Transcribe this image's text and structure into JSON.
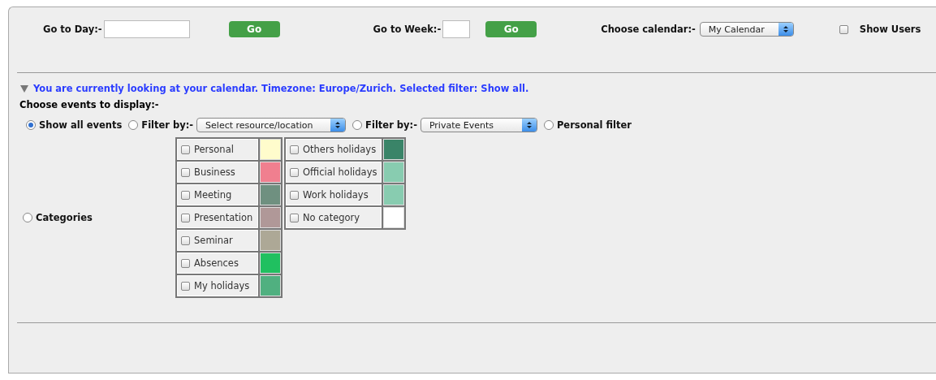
{
  "toolbar": {
    "day": {
      "label": "Go to Day:-",
      "button": "Go"
    },
    "week": {
      "label": "Go to Week:-",
      "button": "Go"
    },
    "calendar": {
      "label": "Choose calendar:-",
      "value": "My Calendar"
    },
    "show_users": {
      "label": "Show Users",
      "checked": false
    }
  },
  "info": {
    "expanded": true,
    "text": "You are currently looking at your calendar. Timezone: Europe/Zurich. Selected filter: Show all."
  },
  "events_heading": "Choose events to display:-",
  "filters": [
    {
      "kind": "radio",
      "label": "Show all events",
      "selected": true
    },
    {
      "kind": "select",
      "label": "Filter by:-",
      "value": "Select resource/location",
      "selected": false
    },
    {
      "kind": "select",
      "label": "Filter by:-",
      "value": "Private Events",
      "selected": false
    },
    {
      "kind": "radio",
      "label": "Personal filter",
      "selected": false
    }
  ],
  "categories": {
    "label": "Categories",
    "selected": false,
    "columns": [
      [
        {
          "name": "Personal",
          "checked": false,
          "color": "#fffccc"
        },
        {
          "name": "Business",
          "checked": false,
          "color": "#f07f8f"
        },
        {
          "name": "Meeting",
          "checked": false,
          "color": "#6f9080"
        },
        {
          "name": "Presentation",
          "checked": false,
          "color": "#b09898"
        },
        {
          "name": "Seminar",
          "checked": false,
          "color": "#ada896"
        },
        {
          "name": "Absences",
          "checked": false,
          "color": "#20c060"
        },
        {
          "name": "My holidays",
          "checked": false,
          "color": "#50b080"
        }
      ],
      [
        {
          "name": "Others holidays",
          "checked": false,
          "color": "#3a8468"
        },
        {
          "name": "Official holidays",
          "checked": false,
          "color": "#88ccb0"
        },
        {
          "name": "Work holidays",
          "checked": false,
          "color": "#88ccb0"
        },
        {
          "name": "No category",
          "checked": false,
          "color": "#ffffff"
        }
      ]
    ]
  }
}
